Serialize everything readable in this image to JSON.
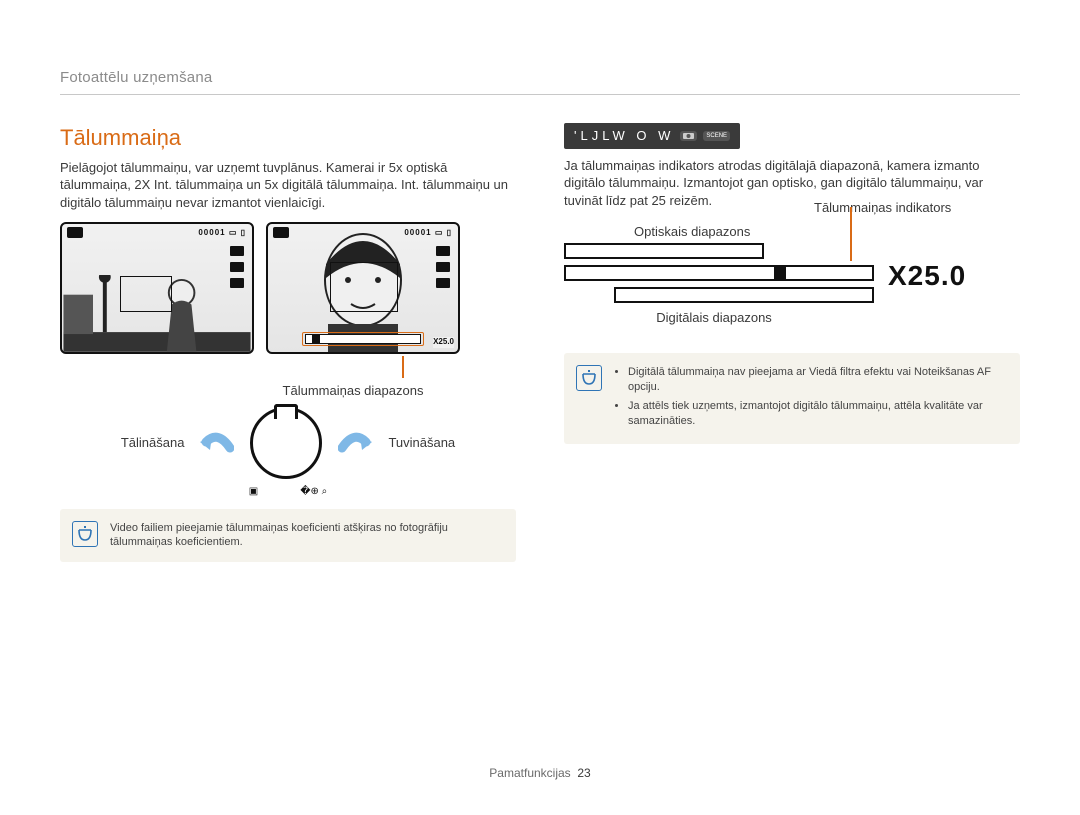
{
  "header": {
    "breadcrumb": "Fotoattēlu uzņemšana"
  },
  "left": {
    "title": "Tālummaiņa",
    "intro": "Pielāgojot tālummaiņu, var uzņemt tuvplānus. Kamerai ir 5x optiskā tālummaiņa, 2X Int. tālummaiņa un 5x digitālā tālummaiņa. Int. tālummaiņu un digitālo tālummaiņu nevar izmantot vienlaicīgi.",
    "osd_counter": "00001",
    "zoom_overlay_readout": "X25.0",
    "caption_range": "Tālummaiņas diapazons",
    "label_zoom_out": "Tālināšana",
    "label_zoom_in": "Tuvināšana",
    "note_text": "Video failiem pieejamie tālummaiņas koeficienti atšķiras no fotogrāfiju tālummaiņas koeficientiem."
  },
  "right": {
    "mode_strip": "'LJLW  O   W",
    "intro": "Ja tālummaiņas indikators atrodas digitālajā diapazonā, kamera izmanto digitālo tālummaiņu. Izmantojot gan optisko, gan digitālo tālummaiņu, var tuvināt līdz pat 25 reizēm.",
    "label_optical": "Optiskais diapazons",
    "label_indicator": "Tālummaiņas indikators",
    "label_digital": "Digitālais diapazons",
    "zoom_readout": "X25.0",
    "notes": [
      "Digitālā tālummaiņa nav pieejama ar Viedā filtra efektu vai Noteikšanas AF opciju.",
      "Ja attēls tiek uzņemts, izmantojot digitālo tālummaiņu, attēla kvalitāte var samazināties."
    ]
  },
  "footer": {
    "label": "Pamatfunkcijas",
    "page": "23"
  }
}
